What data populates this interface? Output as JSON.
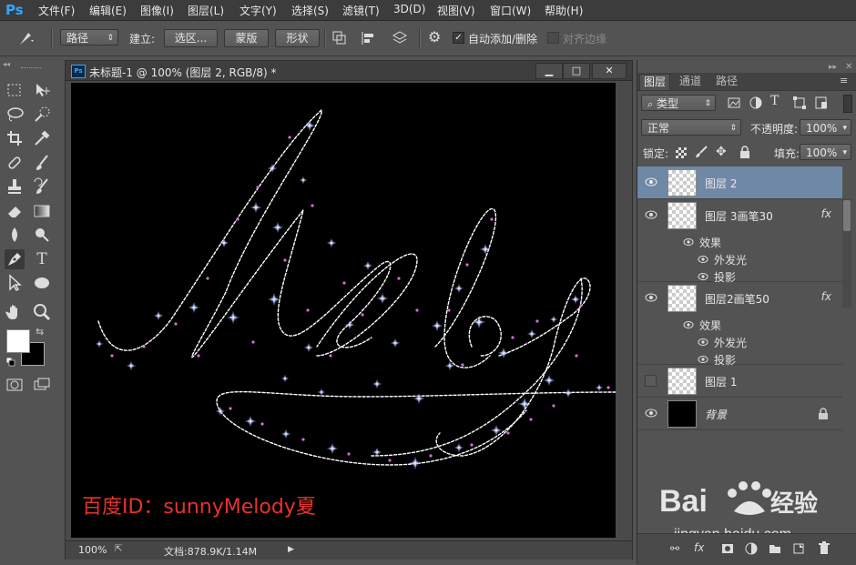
{
  "app": {
    "logo": "Ps"
  },
  "menu": [
    "文件(F)",
    "编辑(E)",
    "图像(I)",
    "图层(L)",
    "文字(Y)",
    "选择(S)",
    "滤镜(T)",
    "3D(D)",
    "视图(V)",
    "窗口(W)",
    "帮助(H)"
  ],
  "options": {
    "mode_select": "路径",
    "build_label": "建立:",
    "selection_btn": "选区...",
    "mask_btn": "蒙版",
    "shape_btn": "形状",
    "auto_add_label": "自动添加/删除",
    "auto_add_checked": true,
    "align_edges_label": "对齐边缘",
    "align_edges_checked": false
  },
  "document": {
    "title": "未标题-1 @ 100% (图层 2, RGB/8) *",
    "zoom": "100%",
    "doc_info": "文档:878.9K/1.14M",
    "watermark": "百度ID：sunnyMelody夏",
    "canvas_color": "#000000",
    "stroke_color": "#ffffff"
  },
  "panel": {
    "tabs": [
      "图层",
      "通道",
      "路径"
    ],
    "active_tab": "图层",
    "filter_kind": "类型",
    "blend_mode": "正常",
    "opacity_label": "不透明度:",
    "opacity_value": "100%",
    "lock_label": "锁定:",
    "fill_label": "填充:",
    "fill_value": "100%",
    "layers": [
      {
        "name": "图层 2",
        "selected": true,
        "visible": true
      },
      {
        "name": "图层 3画笔30",
        "visible": true,
        "fx": "fx",
        "effects_label": "效果",
        "effects": [
          "外发光",
          "投影"
        ]
      },
      {
        "name": "图层2画笔50",
        "visible": true,
        "fx": "fx",
        "effects_label": "效果",
        "effects": [
          "外发光",
          "投影"
        ]
      },
      {
        "name": "图层 1",
        "visible": false
      },
      {
        "name": "背景",
        "visible": true,
        "locked": true
      }
    ]
  },
  "site_watermark": {
    "brand": "Bai du 经验",
    "url": "jingyan.baidu.com"
  }
}
